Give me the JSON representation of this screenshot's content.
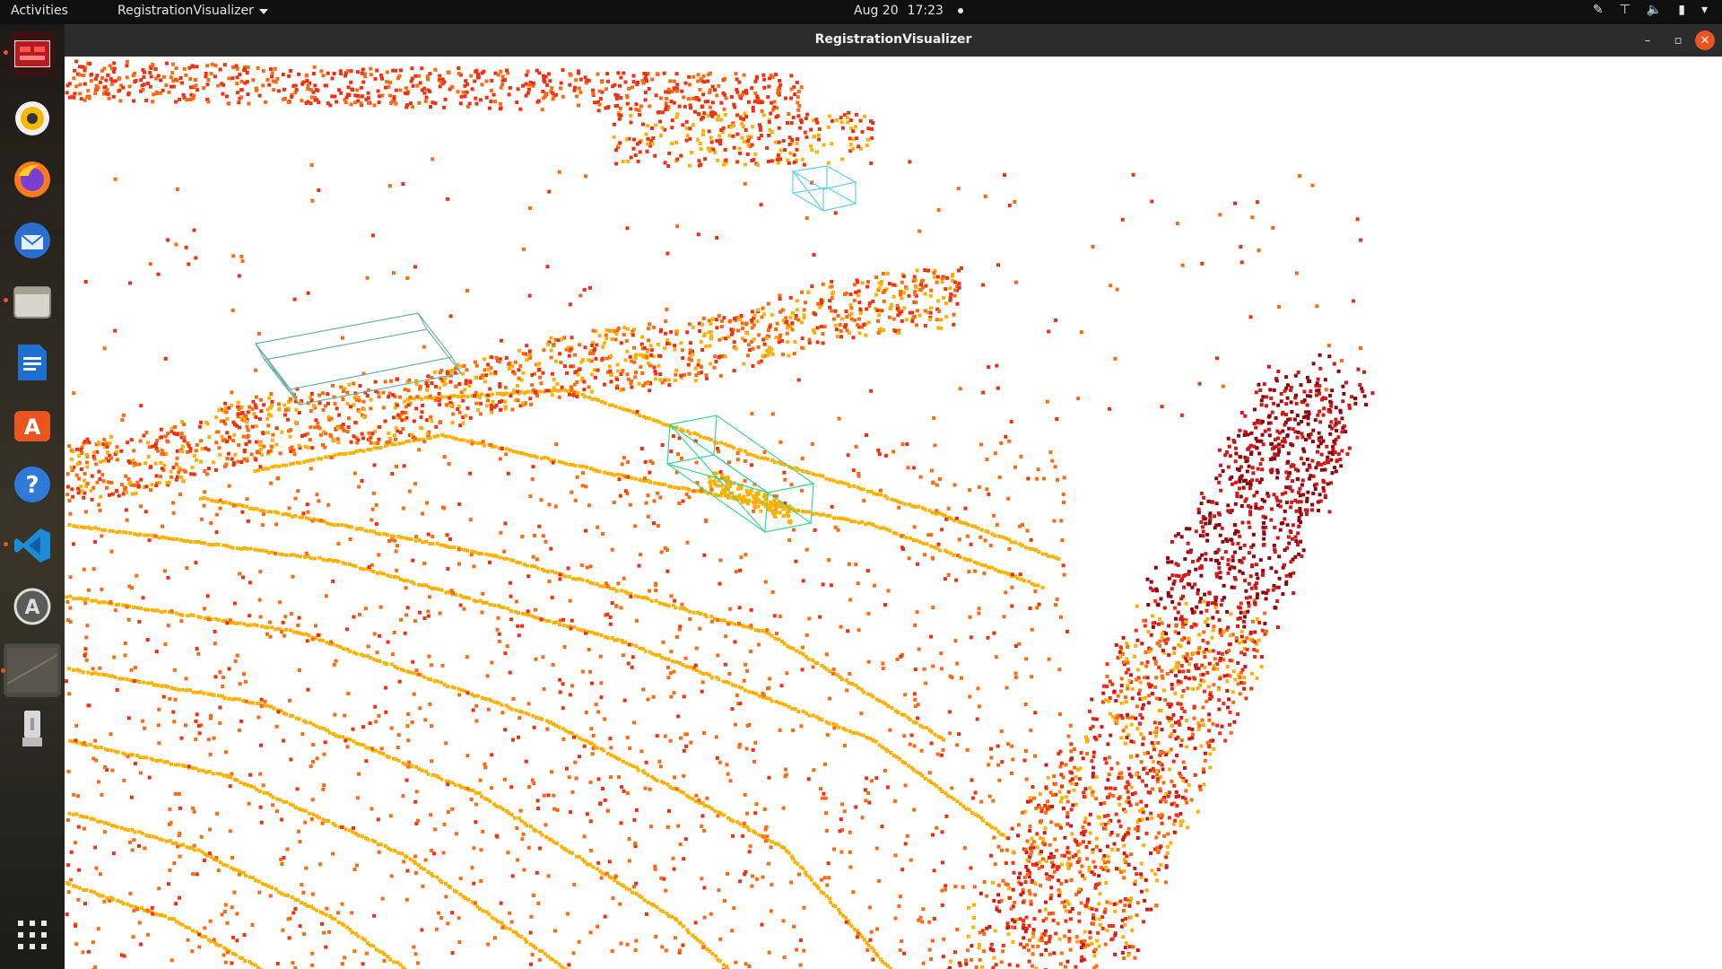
{
  "topbar": {
    "activities": "Activities",
    "app_name": "RegistrationVisualizer",
    "date": "Aug 20",
    "time": "17:23",
    "tray_icons": [
      "pen-icon",
      "network-icon",
      "volume-icon",
      "battery-icon"
    ]
  },
  "dock": {
    "items": [
      "terminal-icon",
      "rhythmbox-icon",
      "firefox-icon",
      "thunderbird-icon",
      "files-icon",
      "writer-icon",
      "software-icon",
      "help-icon",
      "vscode-icon",
      "updater-icon",
      "window-thumbnail-icon",
      "usb-drive-icon"
    ],
    "show_apps": "show-apps-icon"
  },
  "window": {
    "title": "RegistrationVisualizer",
    "controls": [
      "minimize",
      "maximize",
      "close"
    ]
  },
  "viewport": {
    "background": "#ffffff",
    "point_colors": [
      "#ffb000",
      "#ff6a10",
      "#f03010",
      "#d01818",
      "#8c0810"
    ],
    "box_colors": [
      "#6fb0a8",
      "#36d890",
      "#5fd0ee"
    ]
  }
}
